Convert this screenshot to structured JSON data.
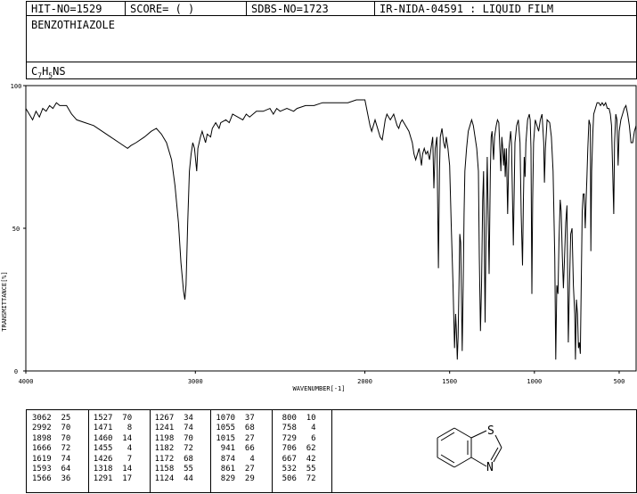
{
  "header": {
    "hit_no": "HIT-NO=1529",
    "score": "SCORE=  (   )",
    "sdbs_no": "SDBS-NO=1723",
    "ir_info": "IR-NIDA-04591 : LIQUID FILM",
    "compound_name": "BENZOTHIAZOLE",
    "formula_base": "C",
    "formula_sub1": "7",
    "formula_mid": "H",
    "formula_sub2": "5",
    "formula_end": "NS"
  },
  "chart_data": {
    "type": "line",
    "xlabel": "WAVENUMBER[-1]",
    "ylabel": "TRANSMITTANCE[%]",
    "xlim": [
      4000,
      400
    ],
    "ylim": [
      0,
      100
    ],
    "x_ticks": [
      4000,
      3000,
      2000,
      1500,
      1000,
      500
    ],
    "y_ticks": [
      0,
      50,
      100
    ],
    "grid": false,
    "series": [
      {
        "points": [
          [
            4000,
            92
          ],
          [
            3980,
            90
          ],
          [
            3960,
            88
          ],
          [
            3940,
            91
          ],
          [
            3920,
            89
          ],
          [
            3900,
            92
          ],
          [
            3880,
            91
          ],
          [
            3860,
            93
          ],
          [
            3840,
            92
          ],
          [
            3820,
            94
          ],
          [
            3800,
            93
          ],
          [
            3760,
            93
          ],
          [
            3730,
            90
          ],
          [
            3700,
            88
          ],
          [
            3650,
            87
          ],
          [
            3600,
            86
          ],
          [
            3550,
            84
          ],
          [
            3500,
            82
          ],
          [
            3450,
            80
          ],
          [
            3400,
            78
          ],
          [
            3380,
            79
          ],
          [
            3350,
            80
          ],
          [
            3300,
            82
          ],
          [
            3260,
            84
          ],
          [
            3230,
            85
          ],
          [
            3200,
            83
          ],
          [
            3170,
            80
          ],
          [
            3140,
            74
          ],
          [
            3120,
            65
          ],
          [
            3100,
            52
          ],
          [
            3085,
            38
          ],
          [
            3070,
            28
          ],
          [
            3062,
            25
          ],
          [
            3055,
            30
          ],
          [
            3045,
            52
          ],
          [
            3035,
            70
          ],
          [
            3025,
            76
          ],
          [
            3015,
            80
          ],
          [
            3005,
            78
          ],
          [
            2992,
            70
          ],
          [
            2985,
            78
          ],
          [
            2970,
            82
          ],
          [
            2960,
            84
          ],
          [
            2940,
            80
          ],
          [
            2930,
            83
          ],
          [
            2910,
            82
          ],
          [
            2900,
            85
          ],
          [
            2880,
            87
          ],
          [
            2860,
            85
          ],
          [
            2850,
            87
          ],
          [
            2820,
            88
          ],
          [
            2800,
            87
          ],
          [
            2780,
            90
          ],
          [
            2750,
            89
          ],
          [
            2720,
            88
          ],
          [
            2700,
            90
          ],
          [
            2680,
            89
          ],
          [
            2660,
            90
          ],
          [
            2640,
            91
          ],
          [
            2600,
            91
          ],
          [
            2560,
            92
          ],
          [
            2540,
            90
          ],
          [
            2520,
            92
          ],
          [
            2500,
            91
          ],
          [
            2460,
            92
          ],
          [
            2420,
            91
          ],
          [
            2400,
            92
          ],
          [
            2350,
            93
          ],
          [
            2300,
            93
          ],
          [
            2250,
            94
          ],
          [
            2200,
            94
          ],
          [
            2150,
            94
          ],
          [
            2100,
            94
          ],
          [
            2050,
            95
          ],
          [
            2000,
            95
          ],
          [
            1990,
            92
          ],
          [
            1980,
            89
          ],
          [
            1970,
            86
          ],
          [
            1960,
            84
          ],
          [
            1950,
            86
          ],
          [
            1940,
            88
          ],
          [
            1930,
            86
          ],
          [
            1920,
            84
          ],
          [
            1910,
            82
          ],
          [
            1898,
            81
          ],
          [
            1890,
            84
          ],
          [
            1880,
            88
          ],
          [
            1870,
            90
          ],
          [
            1860,
            89
          ],
          [
            1850,
            88
          ],
          [
            1840,
            89
          ],
          [
            1830,
            90
          ],
          [
            1820,
            88
          ],
          [
            1810,
            86
          ],
          [
            1800,
            85
          ],
          [
            1790,
            87
          ],
          [
            1780,
            88
          ],
          [
            1760,
            86
          ],
          [
            1740,
            84
          ],
          [
            1720,
            80
          ],
          [
            1710,
            76
          ],
          [
            1700,
            74
          ],
          [
            1690,
            76
          ],
          [
            1680,
            78
          ],
          [
            1666,
            72
          ],
          [
            1660,
            76
          ],
          [
            1650,
            78
          ],
          [
            1640,
            76
          ],
          [
            1630,
            77
          ],
          [
            1619,
            74
          ],
          [
            1610,
            78
          ],
          [
            1600,
            82
          ],
          [
            1593,
            64
          ],
          [
            1585,
            78
          ],
          [
            1575,
            82
          ],
          [
            1566,
            36
          ],
          [
            1560,
            70
          ],
          [
            1555,
            82
          ],
          [
            1545,
            85
          ],
          [
            1535,
            80
          ],
          [
            1527,
            78
          ],
          [
            1520,
            82
          ],
          [
            1510,
            78
          ],
          [
            1500,
            72
          ],
          [
            1490,
            50
          ],
          [
            1480,
            30
          ],
          [
            1471,
            8
          ],
          [
            1465,
            20
          ],
          [
            1460,
            14
          ],
          [
            1455,
            4
          ],
          [
            1450,
            12
          ],
          [
            1445,
            30
          ],
          [
            1440,
            48
          ],
          [
            1435,
            45
          ],
          [
            1426,
            7
          ],
          [
            1420,
            30
          ],
          [
            1415,
            55
          ],
          [
            1410,
            70
          ],
          [
            1400,
            78
          ],
          [
            1390,
            84
          ],
          [
            1380,
            86
          ],
          [
            1370,
            88
          ],
          [
            1360,
            86
          ],
          [
            1350,
            82
          ],
          [
            1340,
            78
          ],
          [
            1330,
            70
          ],
          [
            1325,
            40
          ],
          [
            1318,
            14
          ],
          [
            1312,
            30
          ],
          [
            1305,
            60
          ],
          [
            1300,
            70
          ],
          [
            1291,
            17
          ],
          [
            1285,
            50
          ],
          [
            1278,
            75
          ],
          [
            1267,
            34
          ],
          [
            1260,
            70
          ],
          [
            1255,
            82
          ],
          [
            1250,
            84
          ],
          [
            1241,
            74
          ],
          [
            1235,
            82
          ],
          [
            1225,
            86
          ],
          [
            1218,
            88
          ],
          [
            1210,
            87
          ],
          [
            1205,
            80
          ],
          [
            1198,
            70
          ],
          [
            1192,
            82
          ],
          [
            1187,
            78
          ],
          [
            1182,
            72
          ],
          [
            1176,
            78
          ],
          [
            1172,
            68
          ],
          [
            1165,
            78
          ],
          [
            1158,
            55
          ],
          [
            1150,
            78
          ],
          [
            1140,
            84
          ],
          [
            1135,
            80
          ],
          [
            1124,
            44
          ],
          [
            1115,
            80
          ],
          [
            1105,
            86
          ],
          [
            1095,
            88
          ],
          [
            1085,
            80
          ],
          [
            1078,
            55
          ],
          [
            1070,
            37
          ],
          [
            1065,
            60
          ],
          [
            1060,
            75
          ],
          [
            1055,
            68
          ],
          [
            1050,
            80
          ],
          [
            1040,
            88
          ],
          [
            1030,
            90
          ],
          [
            1025,
            88
          ],
          [
            1020,
            78
          ],
          [
            1015,
            27
          ],
          [
            1010,
            60
          ],
          [
            1005,
            80
          ],
          [
            995,
            88
          ],
          [
            985,
            86
          ],
          [
            975,
            84
          ],
          [
            965,
            88
          ],
          [
            955,
            90
          ],
          [
            945,
            80
          ],
          [
            941,
            66
          ],
          [
            935,
            78
          ],
          [
            925,
            88
          ],
          [
            910,
            87
          ],
          [
            900,
            82
          ],
          [
            890,
            70
          ],
          [
            880,
            40
          ],
          [
            874,
            4
          ],
          [
            868,
            30
          ],
          [
            861,
            27
          ],
          [
            855,
            45
          ],
          [
            848,
            60
          ],
          [
            842,
            56
          ],
          [
            835,
            40
          ],
          [
            829,
            29
          ],
          [
            822,
            40
          ],
          [
            815,
            52
          ],
          [
            808,
            58
          ],
          [
            800,
            10
          ],
          [
            793,
            30
          ],
          [
            786,
            48
          ],
          [
            778,
            50
          ],
          [
            770,
            30
          ],
          [
            762,
            20
          ],
          [
            758,
            4
          ],
          [
            752,
            25
          ],
          [
            746,
            20
          ],
          [
            740,
            8
          ],
          [
            735,
            10
          ],
          [
            729,
            6
          ],
          [
            724,
            30
          ],
          [
            718,
            56
          ],
          [
            712,
            62
          ],
          [
            706,
            62
          ],
          [
            700,
            50
          ],
          [
            695,
            60
          ],
          [
            690,
            68
          ],
          [
            685,
            78
          ],
          [
            678,
            88
          ],
          [
            670,
            86
          ],
          [
            667,
            42
          ],
          [
            662,
            70
          ],
          [
            655,
            84
          ],
          [
            650,
            90
          ],
          [
            640,
            92
          ],
          [
            630,
            94
          ],
          [
            620,
            94
          ],
          [
            610,
            93
          ],
          [
            600,
            94
          ],
          [
            590,
            93
          ],
          [
            580,
            94
          ],
          [
            570,
            92
          ],
          [
            560,
            92
          ],
          [
            552,
            90
          ],
          [
            545,
            86
          ],
          [
            538,
            70
          ],
          [
            532,
            55
          ],
          [
            527,
            80
          ],
          [
            520,
            90
          ],
          [
            513,
            88
          ],
          [
            506,
            72
          ],
          [
            500,
            84
          ],
          [
            490,
            88
          ],
          [
            480,
            90
          ],
          [
            470,
            92
          ],
          [
            460,
            93
          ],
          [
            450,
            90
          ],
          [
            440,
            86
          ],
          [
            430,
            80
          ],
          [
            420,
            80
          ],
          [
            410,
            84
          ],
          [
            400,
            86
          ]
        ]
      }
    ]
  },
  "peak_table": [
    [
      [
        "3062",
        "25"
      ],
      [
        "2992",
        "70"
      ],
      [
        "1898",
        "70"
      ],
      [
        "1666",
        "72"
      ],
      [
        "1619",
        "74"
      ],
      [
        "1593",
        "64"
      ],
      [
        "1566",
        "36"
      ]
    ],
    [
      [
        "1527",
        "70"
      ],
      [
        "1471",
        "8"
      ],
      [
        "1460",
        "14"
      ],
      [
        "1455",
        "4"
      ],
      [
        "1426",
        "7"
      ],
      [
        "1318",
        "14"
      ],
      [
        "1291",
        "17"
      ]
    ],
    [
      [
        "1267",
        "34"
      ],
      [
        "1241",
        "74"
      ],
      [
        "1198",
        "70"
      ],
      [
        "1182",
        "72"
      ],
      [
        "1172",
        "68"
      ],
      [
        "1158",
        "55"
      ],
      [
        "1124",
        "44"
      ]
    ],
    [
      [
        "1070",
        "37"
      ],
      [
        "1055",
        "68"
      ],
      [
        "1015",
        "27"
      ],
      [
        "941",
        "66"
      ],
      [
        "874",
        "4"
      ],
      [
        "861",
        "27"
      ],
      [
        "829",
        "29"
      ]
    ],
    [
      [
        "800",
        "10"
      ],
      [
        "758",
        "4"
      ],
      [
        "729",
        "6"
      ],
      [
        "706",
        "62"
      ],
      [
        "667",
        "42"
      ],
      [
        "532",
        "55"
      ],
      [
        "506",
        "72"
      ]
    ]
  ],
  "structure": {
    "atom_s": "S",
    "atom_n": "N"
  }
}
